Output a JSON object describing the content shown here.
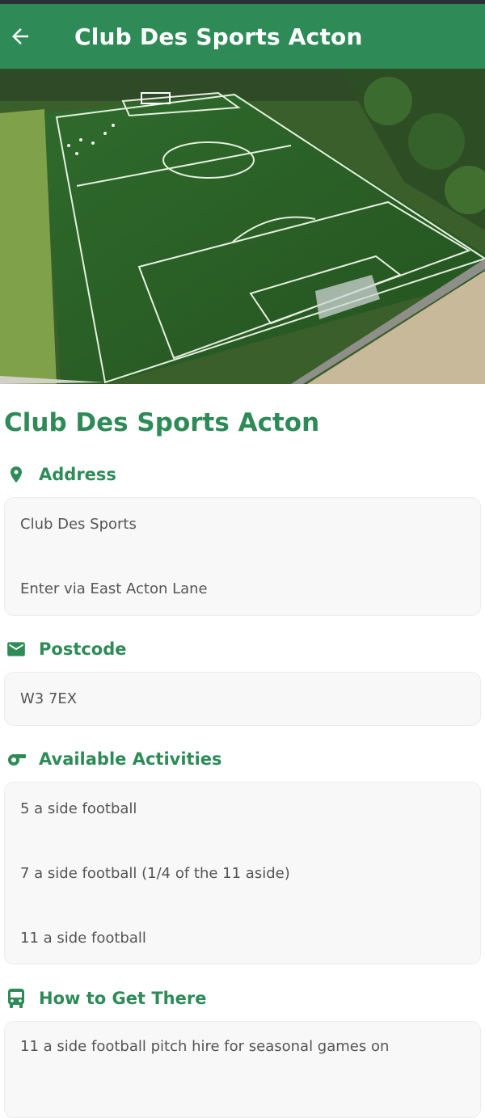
{
  "appbar": {
    "title": "Club Des Sports Acton",
    "back_icon": "arrow-left-icon",
    "color": "#2e8b57"
  },
  "hero": {
    "alt": "Aerial view of football pitch"
  },
  "venue": {
    "name": "Club Des Sports Acton"
  },
  "address": {
    "label": "Address",
    "icon": "map-pin-icon",
    "lines": [
      "Club Des Sports",
      "Enter via East Acton Lane"
    ]
  },
  "postcode": {
    "label": "Postcode",
    "icon": "envelope-icon",
    "value": "W3 7EX"
  },
  "activities": {
    "label": "Available Activities",
    "icon": "whistle-icon",
    "items": [
      "5 a side football",
      "7 a side football (1/4 of the 11 aside)",
      "11 a side football"
    ]
  },
  "directions": {
    "label": "How to Get There",
    "icon": "bus-icon",
    "text": "11 a side football pitch hire for seasonal games on"
  }
}
